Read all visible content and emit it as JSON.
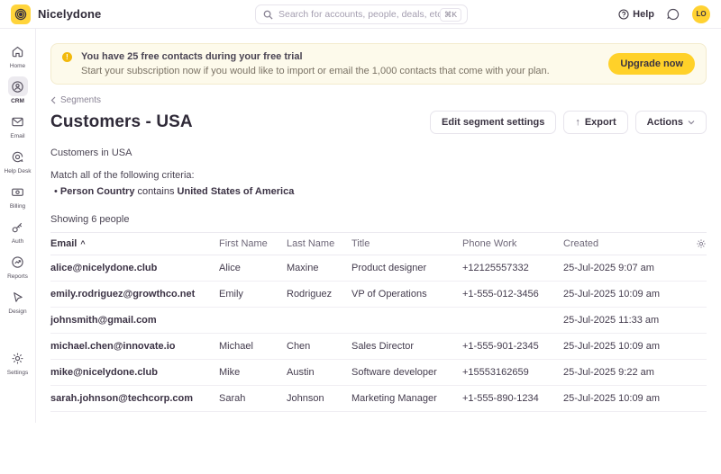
{
  "brand": {
    "name": "Nicelydone"
  },
  "topbar": {
    "search": {
      "placeholder": "Search for accounts, people, deals, etc",
      "shortcut": "⌘K"
    },
    "help_label": "Help",
    "avatar_initials": "LO"
  },
  "sidebar": {
    "items": [
      {
        "label": "Home"
      },
      {
        "label": "CRM"
      },
      {
        "label": "Email"
      },
      {
        "label": "Help Desk"
      },
      {
        "label": "Billing"
      },
      {
        "label": "Auth"
      },
      {
        "label": "Reports"
      },
      {
        "label": "Design"
      }
    ],
    "bottom": {
      "label": "Settings"
    }
  },
  "banner": {
    "title": "You have 25 free contacts during your free trial",
    "subtitle": "Start your subscription now if you would like to import or email the 1,000 contacts that come with your plan.",
    "button_label": "Upgrade now"
  },
  "page": {
    "breadcrumb": "Segments",
    "title": "Customers - USA",
    "edit_button": "Edit segment settings",
    "export_button": "Export",
    "export_icon": "↑",
    "actions_button": "Actions",
    "description": "Customers in USA",
    "criteria_intro": "Match all of the following criteria:",
    "criteria_bullet": "•",
    "criteria": {
      "field": "Person Country",
      "operator": "contains",
      "value": "United States of America"
    },
    "count_text": "Showing 6 people"
  },
  "table": {
    "columns": {
      "email": "Email",
      "first_name": "First Name",
      "last_name": "Last Name",
      "title": "Title",
      "phone_work": "Phone Work",
      "created": "Created"
    },
    "sort": {
      "column": "Email",
      "direction": "asc",
      "caret": "^"
    },
    "rows": [
      {
        "email": "alice@nicelydone.club",
        "first_name": "Alice",
        "last_name": "Maxine",
        "title": "Product designer",
        "phone_work": "+12125557332",
        "created": "25-Jul-2025 9:07 am"
      },
      {
        "email": "emily.rodriguez@growthco.net",
        "first_name": "Emily",
        "last_name": "Rodriguez",
        "title": "VP of Operations",
        "phone_work": "+1-555-012-3456",
        "created": "25-Jul-2025 10:09 am"
      },
      {
        "email": "johnsmith@gmail.com",
        "first_name": "",
        "last_name": "",
        "title": "",
        "phone_work": "",
        "created": "25-Jul-2025 11:33 am"
      },
      {
        "email": "michael.chen@innovate.io",
        "first_name": "Michael",
        "last_name": "Chen",
        "title": "Sales Director",
        "phone_work": "+1-555-901-2345",
        "created": "25-Jul-2025 10:09 am"
      },
      {
        "email": "mike@nicelydone.club",
        "first_name": "Mike",
        "last_name": "Austin",
        "title": "Software developer",
        "phone_work": "+15553162659",
        "created": "25-Jul-2025 9:22 am"
      },
      {
        "email": "sarah.johnson@techcorp.com",
        "first_name": "Sarah",
        "last_name": "Johnson",
        "title": "Marketing Manager",
        "phone_work": "+1-555-890-1234",
        "created": "25-Jul-2025 10:09 am"
      }
    ]
  },
  "colors": {
    "accent_yellow": "#ffd43b",
    "banner_bg": "#fdfaeb",
    "banner_border": "#f3ebcd",
    "text_dark": "#3b3244",
    "text_muted": "#6f6879"
  }
}
